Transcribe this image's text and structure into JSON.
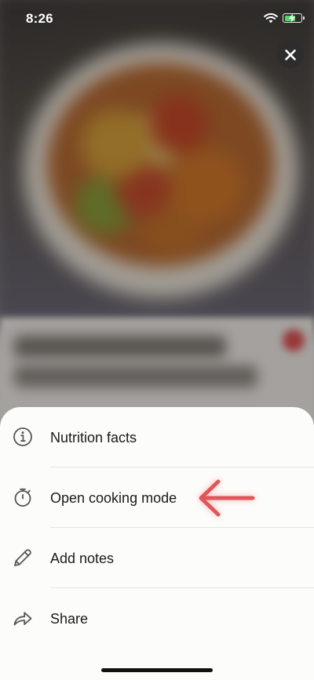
{
  "status_bar": {
    "time": "8:26"
  },
  "close_button": {
    "icon": "close-icon"
  },
  "menu": {
    "items": [
      {
        "label": "Nutrition facts",
        "icon": "info-icon"
      },
      {
        "label": "Open cooking mode",
        "icon": "stopwatch-icon"
      },
      {
        "label": "Add notes",
        "icon": "pencil-icon"
      },
      {
        "label": "Share",
        "icon": "share-arrow-icon"
      }
    ]
  },
  "colors": {
    "annotation_arrow": "#e0565b",
    "battery_charging": "#4cd964",
    "sheet_background": "#fcfcfa"
  }
}
